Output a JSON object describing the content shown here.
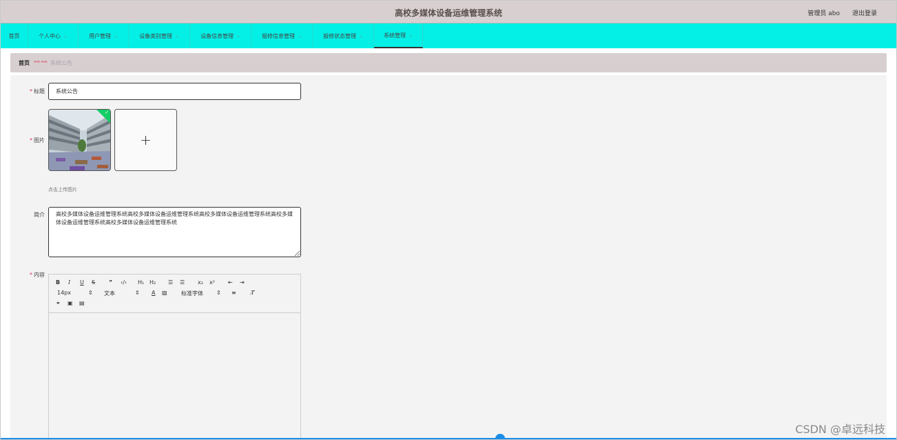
{
  "header": {
    "title": "高校多媒体设备运维管理系统",
    "user": "管理员 abo",
    "logout": "退出登录"
  },
  "nav": {
    "items": [
      {
        "label": "首页",
        "chevron": false
      },
      {
        "label": "个人中心",
        "chevron": true
      },
      {
        "label": "用户管理",
        "chevron": true
      },
      {
        "label": "设备类别管理",
        "chevron": true
      },
      {
        "label": "设备信息管理",
        "chevron": true
      },
      {
        "label": "报修信息管理",
        "chevron": true
      },
      {
        "label": "报修状态管理",
        "chevron": true
      },
      {
        "label": "系统管理",
        "chevron": true,
        "active": true
      }
    ]
  },
  "breadcrumb": {
    "home": "首页",
    "separator": "ᨐᨐ",
    "current": "系统公告"
  },
  "form": {
    "title_label": "标题",
    "title_value": "系统公告",
    "image_label": "图片",
    "upload_tip": "点击上传图片",
    "intro_label": "简介",
    "intro_value": "高校多媒体设备运维管理系统高校多媒体设备运维管理系统高校多媒体设备运维管理系统高校多媒体设备运维管理系统高校多媒体设备运维管理系统",
    "content_label": "内容"
  },
  "editor": {
    "font_size": "14px",
    "block_type": "文本",
    "font_family": "标准字体"
  },
  "watermark": "CSDN @卓远科技"
}
